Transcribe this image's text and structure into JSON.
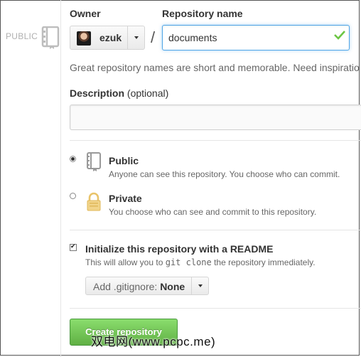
{
  "visibility_badge": "PUBLIC",
  "owner": {
    "label": "Owner",
    "selected": "ezuk"
  },
  "separator": "/",
  "repository": {
    "label": "Repository name",
    "value": "documents"
  },
  "help_text": "Great repository names are short and memorable. Need inspiratio",
  "description": {
    "label": "Description",
    "optional_hint": "(optional)",
    "value": ""
  },
  "visibility_options": [
    {
      "title": "Public",
      "note": "Anyone can see this repository. You choose who can commit.",
      "selected": true,
      "icon": "book-icon"
    },
    {
      "title": "Private",
      "note": "You choose who can see and commit to this repository.",
      "selected": false,
      "icon": "lock-icon"
    }
  ],
  "readme": {
    "checked": true,
    "title": "Initialize this repository with a README",
    "note_before": "This will allow you to",
    "note_code": "git clone",
    "note_after": "the repository immediately."
  },
  "gitignore": {
    "label": "Add .gitignore:",
    "value": "None"
  },
  "create_button": "Create repository",
  "watermark": "双电网(www.pcpc.me)",
  "colors": {
    "focus": "#51a7e8",
    "success": "#60b044",
    "check": "#6cc644"
  }
}
